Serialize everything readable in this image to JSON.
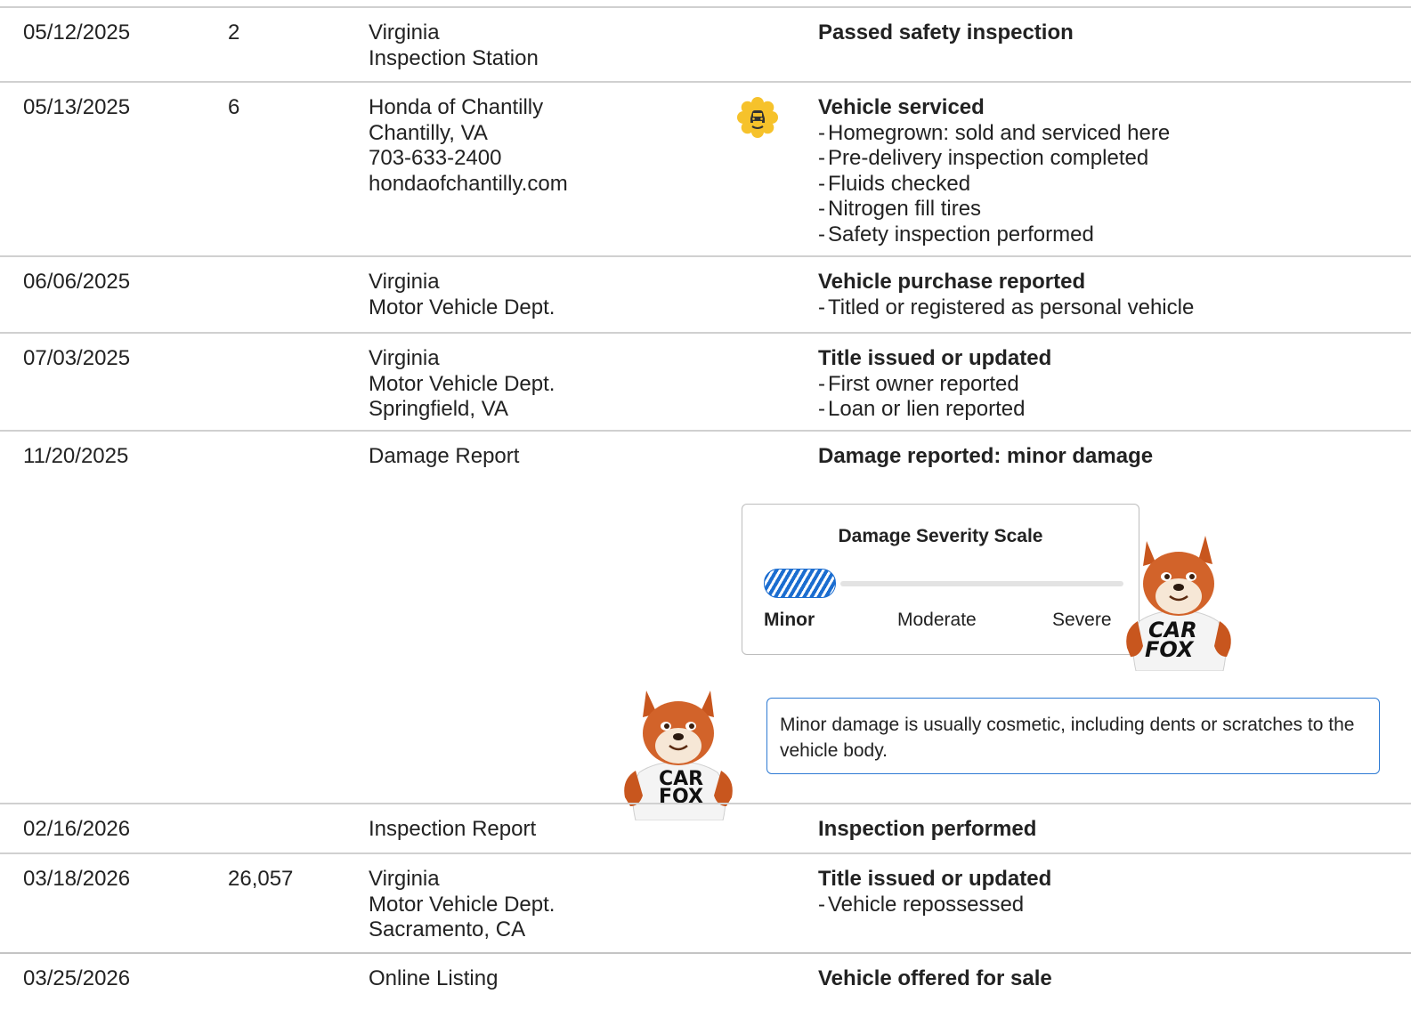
{
  "records": [
    {
      "date": "05/12/2025",
      "mileage": "2",
      "source": [
        "Virginia",
        "Inspection Station"
      ],
      "heading": "Passed safety inspection",
      "details": []
    },
    {
      "date": "05/13/2025",
      "mileage": "6",
      "source": [
        "Honda of Chantilly",
        "Chantilly, VA",
        "703-633-2400",
        "hondaofchantilly.com"
      ],
      "heading": "Vehicle serviced",
      "details": [
        "Homegrown: sold and serviced here",
        "Pre-delivery inspection completed",
        "Fluids checked",
        "Nitrogen fill tires",
        "Safety inspection performed"
      ],
      "icon": "service-badge-icon"
    },
    {
      "date": "06/06/2025",
      "mileage": "",
      "source": [
        "Virginia",
        "Motor Vehicle Dept."
      ],
      "heading": "Vehicle purchase reported",
      "details": [
        "Titled or registered as personal vehicle"
      ]
    },
    {
      "date": "07/03/2025",
      "mileage": "",
      "source": [
        "Virginia",
        "Motor Vehicle Dept.",
        "Springfield, VA"
      ],
      "heading": "Title issued or updated",
      "details": [
        "First owner reported",
        "Loan or lien reported"
      ]
    },
    {
      "date": "11/20/2025",
      "mileage": "",
      "source": [
        "Damage Report"
      ],
      "heading": "Damage reported: minor damage",
      "details": []
    },
    {
      "date": "02/16/2026",
      "mileage": "",
      "source": [
        "Inspection Report"
      ],
      "heading": "Inspection performed",
      "details": []
    },
    {
      "date": "03/18/2026",
      "mileage": "26,057",
      "source": [
        "Virginia",
        "Motor Vehicle Dept.",
        "Sacramento, CA"
      ],
      "heading": "Title issued or updated",
      "details": [
        "Vehicle repossessed"
      ]
    },
    {
      "date": "03/25/2026",
      "mileage": "",
      "source": [
        "Online Listing"
      ],
      "heading": "Vehicle offered for sale",
      "details": []
    }
  ],
  "damage_scale": {
    "title": "Damage Severity Scale",
    "labels": [
      "Minor",
      "Moderate",
      "Severe"
    ],
    "selected": "Minor",
    "level_fraction": 0.25,
    "note": "Minor damage is usually cosmetic, including dents or scratches to the vehicle body."
  },
  "mascot": {
    "shirt_text": [
      "CAR",
      "FOX"
    ]
  },
  "colors": {
    "accent_blue": "#1b6dd0",
    "note_border": "#2f7bd4",
    "badge_yellow": "#f6c22b",
    "divider": "#d0d0d0"
  }
}
